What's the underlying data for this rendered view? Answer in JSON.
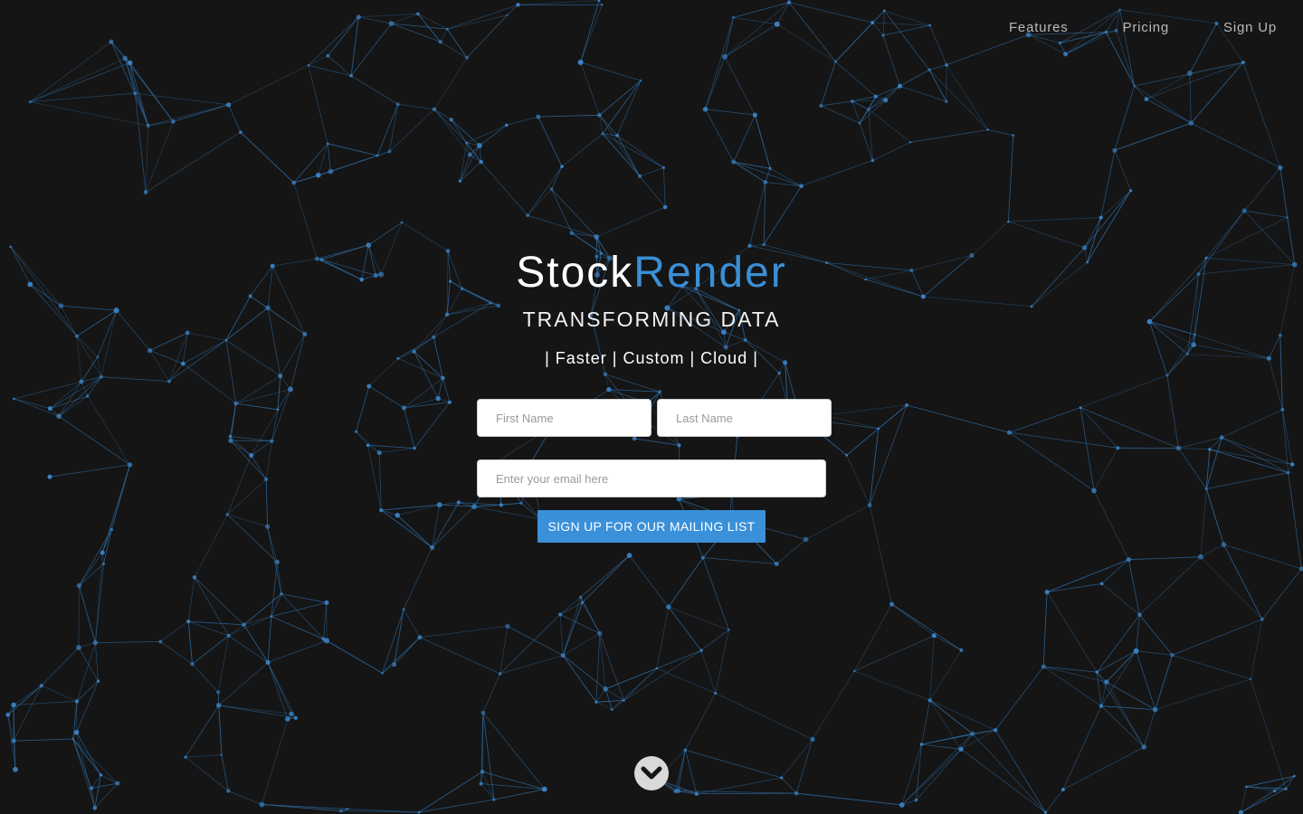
{
  "nav": {
    "items": [
      {
        "label": "Features"
      },
      {
        "label": "Pricing"
      },
      {
        "label": "Sign Up"
      }
    ]
  },
  "hero": {
    "brand_primary": "Stock",
    "brand_accent": "Render",
    "tagline": "TRANSFORMING DATA",
    "features_line": "| Faster | Custom | Cloud |"
  },
  "form": {
    "first_name_placeholder": "First Name",
    "first_name_value": "",
    "last_name_placeholder": "Last Name",
    "last_name_value": "",
    "email_placeholder": "Enter your email here",
    "email_value": "",
    "submit_label": "SIGN UP FOR OUR MAILING LIST"
  },
  "scroll": {
    "icon": "chevron-down-icon"
  },
  "colors": {
    "background": "#151515",
    "accent": "#3a8fd6",
    "network_line": "#2f6ea6",
    "network_node": "#3b82c4",
    "button": "#3a90d9"
  }
}
